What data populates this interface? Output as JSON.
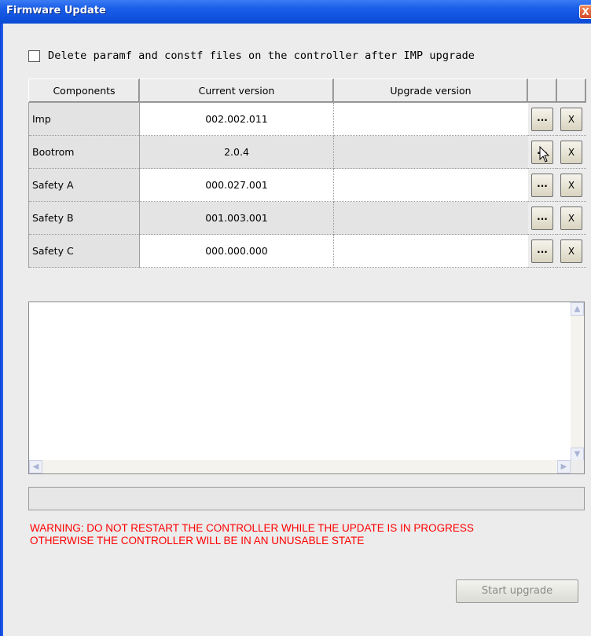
{
  "window": {
    "title": "Firmware Update",
    "close_label": "X",
    "close_icon": "close-icon"
  },
  "options": {
    "delete_files_label": "Delete paramf and constf files on the controller after IMP upgrade",
    "delete_files_checked": false
  },
  "components_table": {
    "headers": {
      "component": "Components",
      "current": "Current version",
      "upgrade": "Upgrade version",
      "browse": "",
      "clear": ""
    },
    "browse_label": "...",
    "clear_label": "X",
    "rows": [
      {
        "component": "Imp",
        "current": "002.002.011",
        "upgrade": ""
      },
      {
        "component": "Bootrom",
        "current": "2.0.4",
        "upgrade": ""
      },
      {
        "component": "Safety A",
        "current": "000.027.001",
        "upgrade": ""
      },
      {
        "component": "Safety B",
        "current": "001.003.001",
        "upgrade": ""
      },
      {
        "component": "Safety C",
        "current": "000.000.000",
        "upgrade": ""
      }
    ]
  },
  "log": {
    "text": "",
    "scroll_up_icon": "chevron-up-icon",
    "scroll_down_icon": "chevron-down-icon",
    "scroll_left_icon": "chevron-left-icon",
    "scroll_right_icon": "chevron-right-icon"
  },
  "progress": {
    "value": 0
  },
  "warning": {
    "line1": "WARNING: DO NOT RESTART THE CONTROLLER WHILE THE UPDATE IS IN PROGRESS",
    "line2": "OTHERWISE THE CONTROLLER WILL BE IN AN UNUSABLE STATE",
    "color": "#ff0000"
  },
  "actions": {
    "start_label": "Start upgrade",
    "start_enabled": false
  },
  "theme": {
    "titlebar": "#0a4ad6",
    "window_bg": "#ececec"
  }
}
